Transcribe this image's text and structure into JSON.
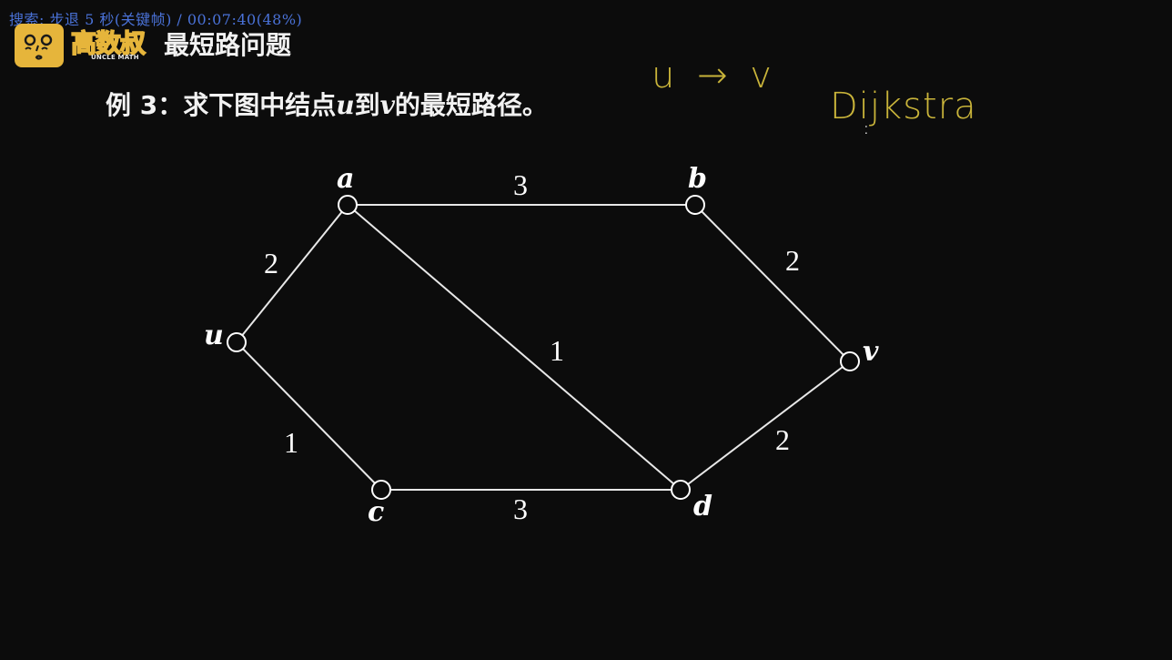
{
  "player": {
    "osd_text": "搜索: 步退 5 秒(关键帧) / 00:07:40(48%)"
  },
  "branding": {
    "logo_icon": "cartoon-face-icon",
    "name_cn": "高数叔",
    "name_en": "UNCLE MATH",
    "brand_color": "#e6b53b"
  },
  "slide": {
    "title": "最短路问题",
    "problem_prefix": "例 3：求下图中结点",
    "problem_u": "u",
    "problem_mid": "到",
    "problem_v": "v",
    "problem_suffix": "的最短路径。"
  },
  "annotations": {
    "u_to_v": "u → v",
    "algorithm": "Dijkstra",
    "ink_color": "#c9b43a"
  },
  "graph": {
    "nodes": [
      {
        "id": "a",
        "label": "a"
      },
      {
        "id": "b",
        "label": "b"
      },
      {
        "id": "u",
        "label": "u"
      },
      {
        "id": "v",
        "label": "v"
      },
      {
        "id": "c",
        "label": "c"
      },
      {
        "id": "d",
        "label": "d"
      }
    ],
    "edges": [
      {
        "from": "a",
        "to": "b",
        "weight": "3"
      },
      {
        "from": "u",
        "to": "a",
        "weight": "2"
      },
      {
        "from": "b",
        "to": "v",
        "weight": "2"
      },
      {
        "from": "a",
        "to": "d",
        "weight": "1"
      },
      {
        "from": "u",
        "to": "c",
        "weight": "1"
      },
      {
        "from": "d",
        "to": "v",
        "weight": "2"
      },
      {
        "from": "c",
        "to": "d",
        "weight": "3"
      }
    ]
  }
}
